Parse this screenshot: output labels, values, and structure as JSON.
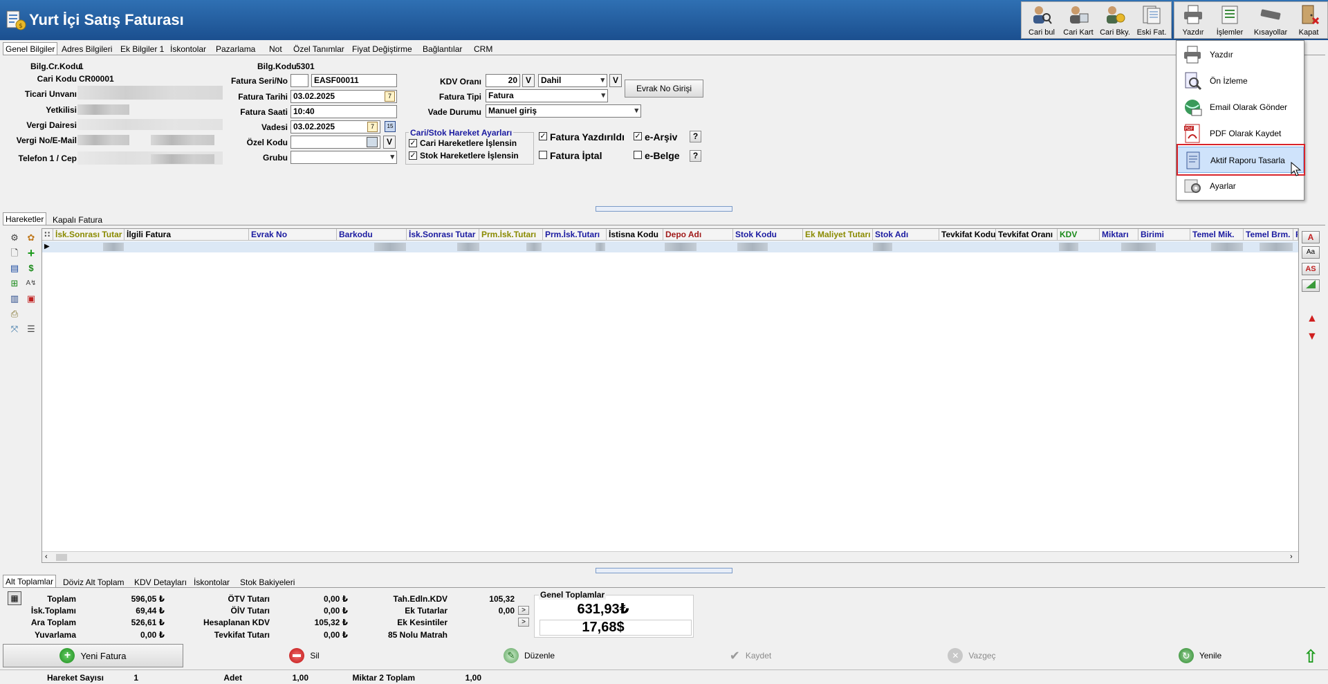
{
  "window": {
    "title": "Yurt İçi Satış Faturası"
  },
  "toolbar": {
    "cari_bul": "Cari bul",
    "cari_kart": "Cari Kart",
    "cari_bky": "Cari Bky.",
    "eski_fat": "Eski Fat.",
    "yazdir": "Yazdır",
    "islemler": "İşlemler",
    "kisayollar": "Kısayollar",
    "kapat": "Kapat"
  },
  "tabs": [
    "Genel Bilgiler",
    "Adres Bilgileri",
    "Ek Bilgiler 1",
    "İskontolar",
    "Pazarlama",
    "Not",
    "Özel Tanımlar",
    "Fiyat Değiştirme",
    "Bağlantılar",
    "CRM"
  ],
  "form": {
    "bilg_cr_kodu_label": "Bilg.Cr.Kodu",
    "bilg_cr_kodu_value": "1",
    "cari_kodu_label": "Cari Kodu",
    "cari_kodu_value": "CR00001",
    "ticari_unvan_label": "Ticari Unvanı",
    "yetkili_label": "Yetkilisi",
    "vergi_dairesi_label": "Vergi Dairesi",
    "vergi_no_label": "Vergi No/E-Mail",
    "telefon_label": "Telefon 1 / Cep",
    "bilg_kodu_label": "Bilg.Kodu",
    "bilg_kodu_value": "5301",
    "fatura_seri_label": "Fatura Seri/No",
    "fatura_seri_value": "",
    "fatura_no_value": "EASF00011",
    "fatura_tarihi_label": "Fatura Tarihi",
    "fatura_tarihi_value": "03.02.2025",
    "fatura_saati_label": "Fatura Saati",
    "fatura_saati_value": "10:40",
    "vadesi_label": "Vadesi",
    "vadesi_value": "03.02.2025",
    "ozel_kodu_label": "Özel Kodu",
    "ozel_kodu_value": "",
    "grubu_label": "Grubu",
    "grubu_value": "",
    "v_button": "V",
    "kdv_orani_label": "KDV Oranı",
    "kdv_orani_value": "20",
    "kdv_mode_value": "Dahil",
    "fatura_tipi_label": "Fatura Tipi",
    "fatura_tipi_value": "Fatura",
    "vade_durumu_label": "Vade Durumu",
    "vade_durumu_value": "Manuel giriş",
    "evrak_no_button": "Evrak No Girişi",
    "hareket_group_title": "Cari/Stok Hareket Ayarları",
    "cari_hareket_label": "Cari Hareketlere İşlensin",
    "stok_hareket_label": "Stok Hareketlere İşlensin",
    "fatura_yazdirildi_label": "Fatura Yazdırıldı",
    "fatura_iptal_label": "Fatura İptal",
    "e_arsiv_label": "e-Arşiv",
    "e_belge_label": "e-Belge",
    "help_label": "?"
  },
  "mid_tabs": [
    "Hareketler",
    "Kapalı Fatura"
  ],
  "grid": {
    "columns": [
      {
        "label": "İsk.Sonrası Tutar",
        "color": "#8a8a00"
      },
      {
        "label": "İlgili Fatura",
        "color": "#000000"
      },
      {
        "label": "Evrak No",
        "color": "#1a1aa0"
      },
      {
        "label": "Barkodu",
        "color": "#1a1aa0"
      },
      {
        "label": "İsk.Sonrası Tutar",
        "color": "#1a1aa0"
      },
      {
        "label": "Prm.İsk.Tutarı",
        "color": "#8a8a00"
      },
      {
        "label": "Prm.İsk.Tutarı",
        "color": "#1a1aa0"
      },
      {
        "label": "İstisna Kodu",
        "color": "#000000"
      },
      {
        "label": "Depo Adı",
        "color": "#a01a1a"
      },
      {
        "label": "Stok Kodu",
        "color": "#1a1aa0"
      },
      {
        "label": "Ek Maliyet Tutarı",
        "color": "#8a8a00"
      },
      {
        "label": "Stok Adı",
        "color": "#1a1aa0"
      },
      {
        "label": "Tevkifat Kodu",
        "color": "#000000"
      },
      {
        "label": "Tevkifat Oranı",
        "color": "#000000"
      },
      {
        "label": "KDV",
        "color": "#1a8a1a"
      },
      {
        "label": "Miktarı",
        "color": "#1a1aa0"
      },
      {
        "label": "Birimi",
        "color": "#1a1aa0"
      },
      {
        "label": "Temel Mik.",
        "color": "#1a1aa0"
      },
      {
        "label": "Temel Brm.",
        "color": "#1a1aa0"
      },
      {
        "label": "F",
        "color": "#1a1aa0"
      }
    ]
  },
  "bottom_tabs": [
    "Alt Toplamlar",
    "Döviz Alt Toplam",
    "KDV Detayları",
    "İskontolar",
    "Stok Bakiyeleri"
  ],
  "totals": {
    "toplam_label": "Toplam",
    "toplam_value": "596,05 ₺",
    "isk_toplami_label": "İsk.Toplamı",
    "isk_toplami_value": "69,44 ₺",
    "ara_toplam_label": "Ara Toplam",
    "ara_toplam_value": "526,61 ₺",
    "yuvarlama_label": "Yuvarlama",
    "yuvarlama_value": "0,00 ₺",
    "otv_label": "ÖTV Tutarı",
    "otv_value": "0,00 ₺",
    "oiv_label": "ÖİV Tutarı",
    "oiv_value": "0,00 ₺",
    "hesaplanan_kdv_label": "Hesaplanan KDV",
    "hesaplanan_kdv_value": "105,32 ₺",
    "tevkifat_label": "Tevkifat Tutarı",
    "tevkifat_value": "0,00 ₺",
    "tah_edln_kdv_label": "Tah.Edln.KDV",
    "tah_edln_kdv_value": "105,32",
    "ek_tutarlar_label": "Ek Tutarlar",
    "ek_tutarlar_value": "0,00",
    "ek_kesintiler_label": "Ek Kesintiler",
    "matrah_label": "85 Nolu Matrah",
    "arrow_label": ">",
    "genel_toplamlar_title": "Genel Toplamlar",
    "genel_try": "631,93₺",
    "genel_usd": "17,68$"
  },
  "actions": {
    "yeni_fatura": "Yeni Fatura",
    "sil": "Sil",
    "duzenle": "Düzenle",
    "kaydet": "Kaydet",
    "vazgec": "Vazgeç",
    "yenile": "Yenile"
  },
  "status": {
    "hareket_sayisi_label": "Hareket Sayısı",
    "hareket_sayisi_value": "1",
    "adet_label": "Adet",
    "adet_value": "1,00",
    "miktar2_label": "Miktar 2 Toplam",
    "miktar2_value": "1,00"
  },
  "menu": {
    "items": [
      "Yazdır",
      "Ön İzleme",
      "Email Olarak Gönder",
      "PDF Olarak Kaydet",
      "Aktif Raporu Tasarla",
      "Ayarlar"
    ],
    "highlighted_index": 4
  },
  "side_icons": [
    "gear-icon",
    "palette-icon",
    "new-doc-icon",
    "plus-icon",
    "doc-icon",
    "dollar-icon",
    "add-row-icon",
    "sort-icon",
    "columns-icon",
    "stop-icon",
    "export-icon",
    "link-icon",
    "list-icon"
  ],
  "right_icons": {
    "font": "A",
    "font_size": "Aa",
    "as": "AS"
  }
}
